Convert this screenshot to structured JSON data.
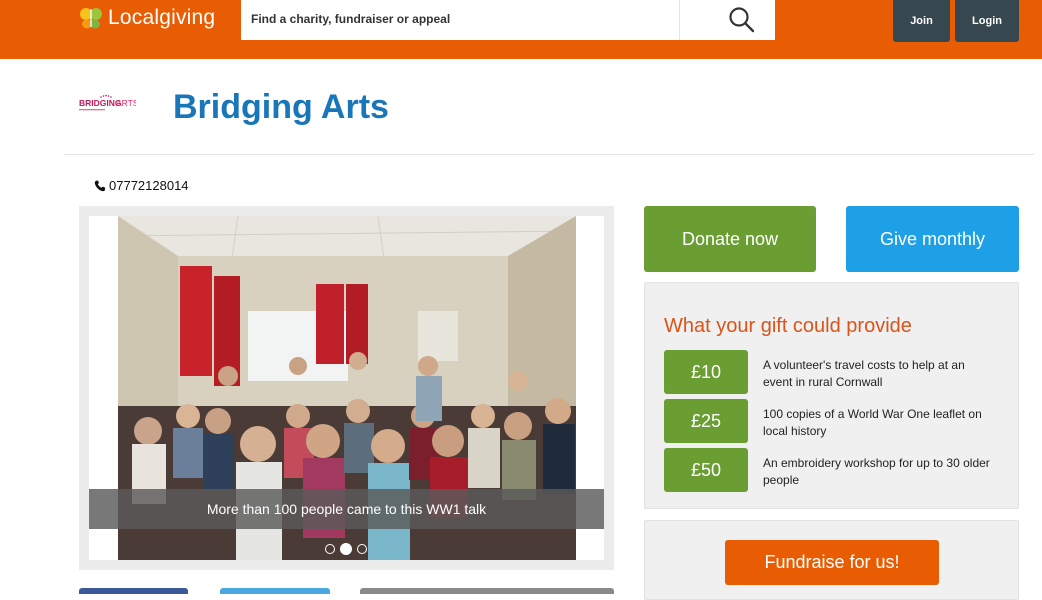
{
  "header": {
    "logo_text": "Localgiving",
    "search_placeholder": "Find a charity, fundraiser or appeal",
    "join_label": "Join",
    "login_label": "Login",
    "brand_color": "#e85d04"
  },
  "charity": {
    "logo_text": "BRIDGINGARTS",
    "name": "Bridging Arts",
    "phone": "07772128014"
  },
  "slideshow": {
    "caption": "More than 100 people came to this WW1 talk",
    "slide_count": 3,
    "active_slide": 2
  },
  "actions": {
    "donate_label": "Donate now",
    "monthly_label": "Give monthly",
    "fundraise_label": "Fundraise for us!"
  },
  "gifts": {
    "title": "What your gift could provide",
    "items": [
      {
        "amount": "£10",
        "description": "A volunteer's travel costs to help at an event in rural Cornwall"
      },
      {
        "amount": "£25",
        "description": "100 copies of a World War One leaflet on local history"
      },
      {
        "amount": "£50",
        "description": "An embroidery workshop for up to 30 older people"
      }
    ]
  },
  "colors": {
    "green": "#6a9e33",
    "blue": "#1da0e6",
    "orange": "#e85d04",
    "title_blue": "#1976b8"
  }
}
